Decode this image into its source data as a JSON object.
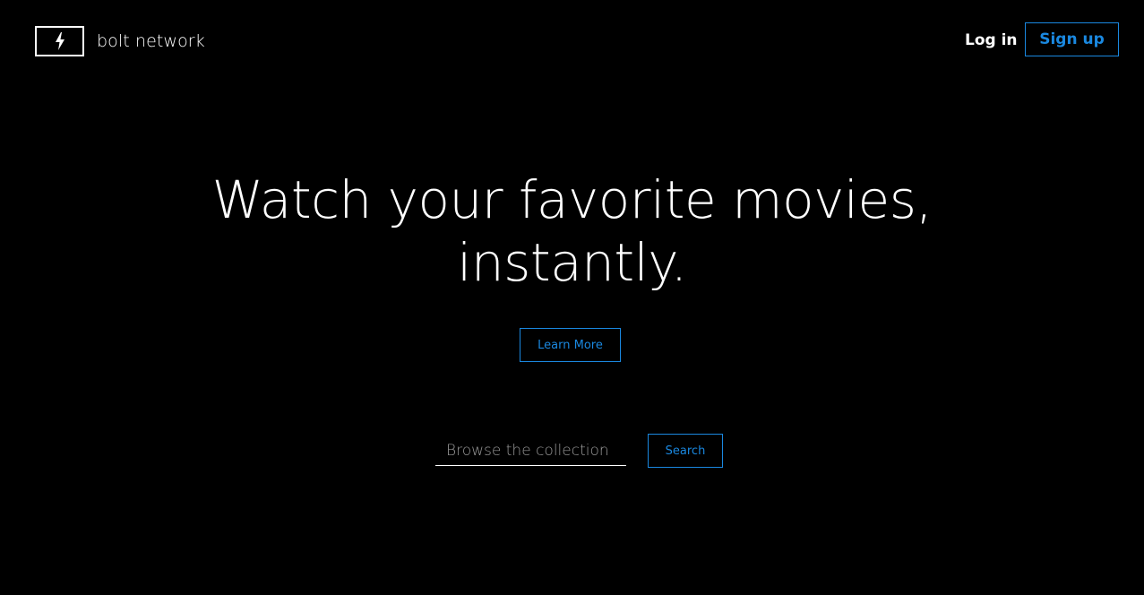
{
  "header": {
    "brand_name": "bolt network",
    "logo_icon": "lightning-bolt-icon",
    "login_label": "Log in",
    "signup_label": "Sign up"
  },
  "hero": {
    "title_line1": "Watch your favorite movies,",
    "title_line2": "instantly.",
    "learn_more_label": "Learn More"
  },
  "search": {
    "placeholder": "Browse the collection",
    "value": "",
    "button_label": "Search"
  },
  "colors": {
    "background": "#000000",
    "text": "#ffffff",
    "accent": "#1a88e0",
    "placeholder": "#9a9a9a"
  }
}
